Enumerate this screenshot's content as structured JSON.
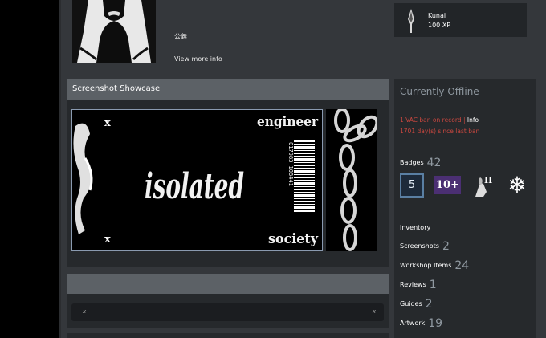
{
  "profile": {
    "tag": "公義",
    "view_more": "View more info"
  },
  "xp_badge": {
    "name": "Kunai",
    "xp": "100 XP"
  },
  "showcase": {
    "title": "Screenshot Showcase",
    "artwork_text": {
      "main_word": "isolated",
      "top_word": "engineer",
      "bottom_word": "society",
      "barcode_number": "017983 108441",
      "corner_mark": "x"
    }
  },
  "lower_box": {
    "mark_left": "x",
    "mark_right": "x"
  },
  "sidebar": {
    "status": "Currently Offline",
    "vac_text": "1 VAC ban on record",
    "vac_sep": " | ",
    "vac_info": "Info",
    "days_since": "1701 day(s) since last ban",
    "badges_label": "Badges",
    "badges_count": "42",
    "badge_level": "5",
    "badge_years": "10+",
    "badge_roman": "II",
    "links": [
      {
        "label": "Inventory",
        "count": ""
      },
      {
        "label": "Screenshots",
        "count": "2"
      },
      {
        "label": "Workshop Items",
        "count": "24"
      },
      {
        "label": "Reviews",
        "count": "1"
      },
      {
        "label": "Guides",
        "count": "2"
      },
      {
        "label": "Artwork",
        "count": "19"
      }
    ]
  },
  "colors": {
    "page_bg": "#34373b",
    "panel_bg": "#26292c",
    "header_bg": "#5c6166",
    "ban_red": "#c9473f",
    "muted": "#8f98a0"
  }
}
